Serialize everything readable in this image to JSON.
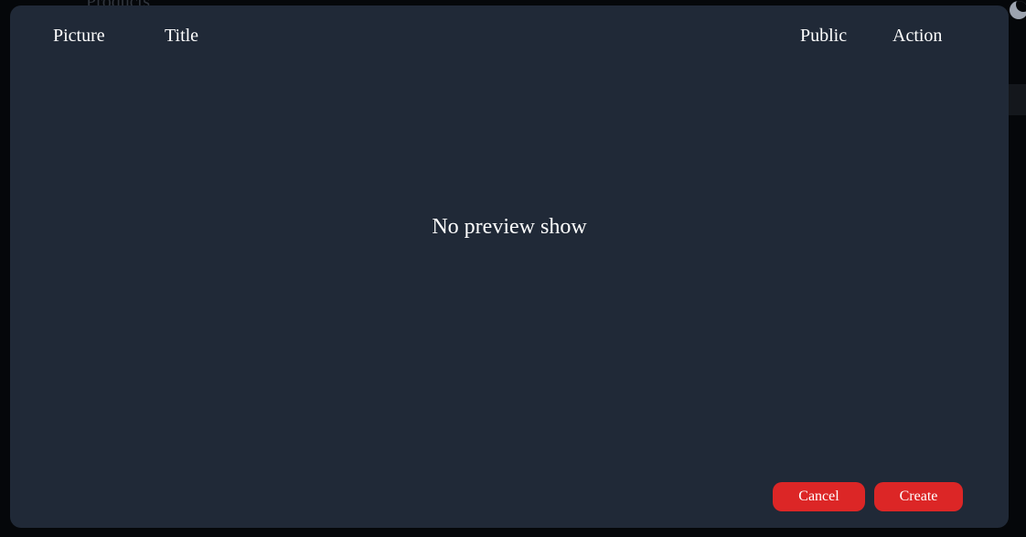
{
  "background": {
    "page_title": "Products"
  },
  "table": {
    "columns": [
      "Picture",
      "Title",
      "Public",
      "Action"
    ],
    "empty_message": "No preview show"
  },
  "buttons": {
    "cancel_label": "Cancel",
    "create_label": "Create"
  },
  "icons": {
    "theme_toggle": "moon-icon",
    "more": "more-dots-icon"
  },
  "colors": {
    "backdrop": "#05070a",
    "modal_bg": "#202937",
    "button_primary": "#dc2626",
    "text": "#ffffff"
  }
}
